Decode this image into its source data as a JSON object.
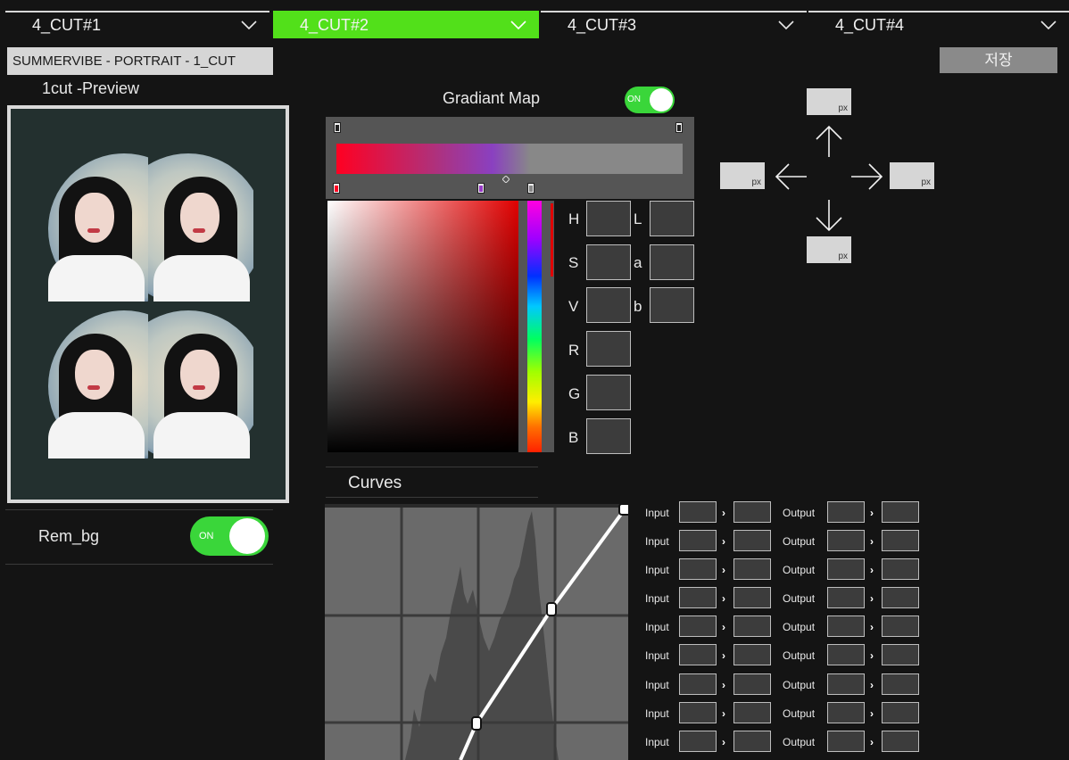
{
  "tabs": [
    {
      "label": "4_CUT#1",
      "active": false
    },
    {
      "label": "4_CUT#2",
      "active": true
    },
    {
      "label": "4_CUT#3",
      "active": false
    },
    {
      "label": "4_CUT#4",
      "active": false
    }
  ],
  "project_title": "SUMMERVIBE - PORTRAIT - 1_CUT",
  "save_label": "저장",
  "preview_label": "1cut -Preview",
  "rembg": {
    "label": "Rem_bg",
    "toggle_text": "ON"
  },
  "gradient_map": {
    "label": "Gradiant Map",
    "toggle_text": "ON"
  },
  "channels": {
    "h": "H",
    "s": "S",
    "v": "V",
    "r": "R",
    "g": "G",
    "b": "B",
    "l": "L",
    "a": "a",
    "lab_b": "b"
  },
  "curves": {
    "label": "Curves"
  },
  "curve_rows": [
    {
      "input": "Input",
      "output": "Output"
    },
    {
      "input": "Input",
      "output": "Output"
    },
    {
      "input": "Input",
      "output": "Output"
    },
    {
      "input": "Input",
      "output": "Output"
    },
    {
      "input": "Input",
      "output": "Output"
    },
    {
      "input": "Input",
      "output": "Output"
    },
    {
      "input": "Input",
      "output": "Output"
    },
    {
      "input": "Input",
      "output": "Output"
    },
    {
      "input": "Input",
      "output": "Output"
    }
  ],
  "offset_unit": "px",
  "colors": {
    "accent_green": "#52e01a",
    "toggle_green": "#3ad63a",
    "panel": "#555555"
  }
}
